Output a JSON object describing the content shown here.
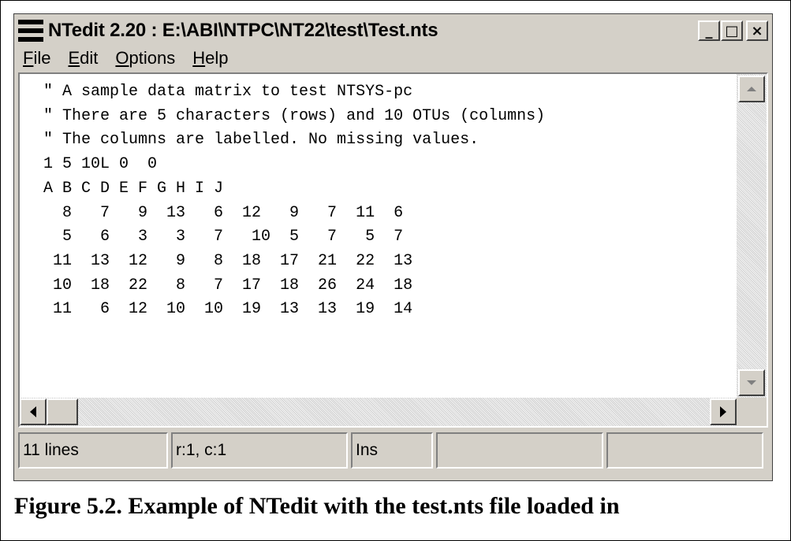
{
  "window": {
    "title": "NTedit 2.20 : E:\\ABI\\NTPC\\NT22\\test\\Test.nts",
    "buttons": {
      "minimize": "_",
      "maximize": "□",
      "close": "×"
    }
  },
  "menu": [
    {
      "accel": "F",
      "rest": "ile"
    },
    {
      "accel": "E",
      "rest": "dit"
    },
    {
      "accel": "O",
      "rest": "ptions"
    },
    {
      "accel": "H",
      "rest": "elp"
    }
  ],
  "editor": {
    "content": "\" A sample data matrix to test NTSYS-pc\n\" There are 5 characters (rows) and 10 OTUs (columns)\n\" The columns are labelled. No missing values.\n1 5 10L 0  0\nA B C D E F G H I J\n  8   7   9  13   6  12   9   7  11  6\n  5   6   3   3   7   10  5   7   5  7\n 11  13  12   9   8  18  17  21  22  13\n 10  18  22   8   7  17  18  26  24  18\n 11   6  12  10  10  19  13  13  19  14"
  },
  "status": {
    "lines": "11 lines",
    "position": "r:1, c:1",
    "mode": "Ins",
    "extra1": "",
    "extra2": ""
  },
  "caption": "Figure 5.2. Example of NTedit with the test.nts file loaded in"
}
